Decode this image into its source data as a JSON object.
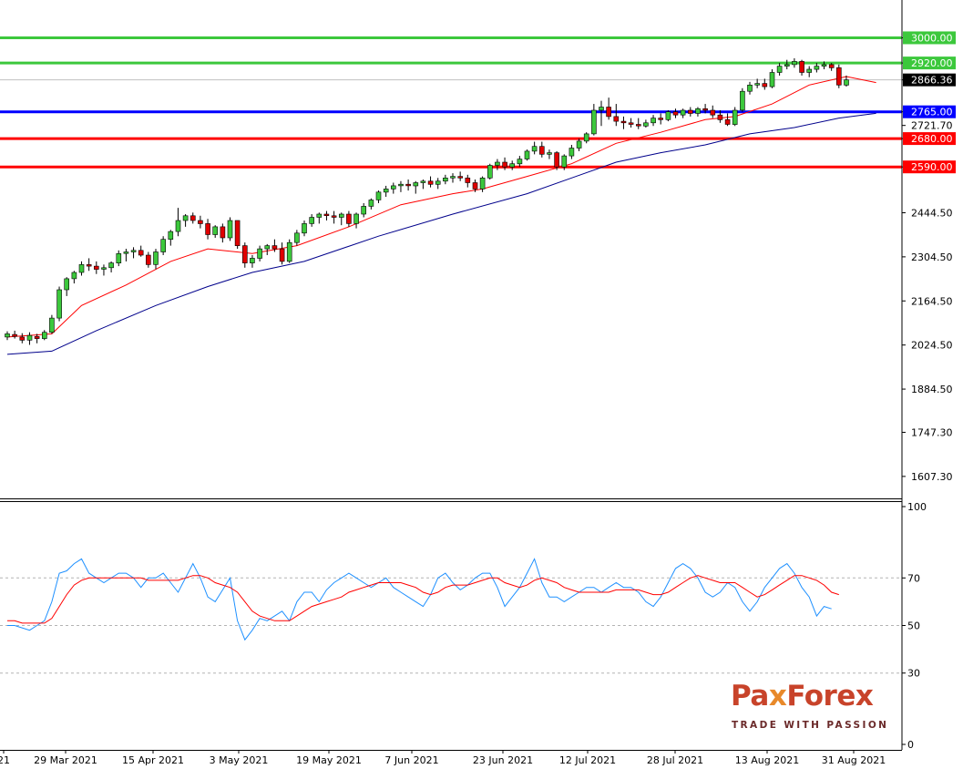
{
  "chart_data": [
    {
      "type": "candlestick",
      "panel": "price",
      "ylim": [
        1537.5,
        3120
      ],
      "y_ticks": [
        "3000.00",
        "2920.00",
        "2866.36",
        "2765.00",
        "2721.70",
        "2680.00",
        "2590.00",
        "2444.50",
        "2304.50",
        "2164.50",
        "2024.50",
        "1884.50",
        "1747.30",
        "1607.30"
      ],
      "x_labels": [
        "21",
        "29 Mar 2021",
        "15 Apr 2021",
        "3 May 2021",
        "19 May 2021",
        "7 Jun 2021",
        "23 Jun 2021",
        "12 Jul 2021",
        "28 Jul 2021",
        "13 Aug 2021",
        "31 Aug 2021"
      ],
      "levels": [
        {
          "value": 3000,
          "label": "3000.00",
          "color": "#3cc83c"
        },
        {
          "value": 2920,
          "label": "2920.00",
          "color": "#3cc83c"
        },
        {
          "value": 2765,
          "label": "2765.00",
          "color": "#0000ff"
        },
        {
          "value": 2680,
          "label": "2680.00",
          "color": "#ff0000"
        },
        {
          "value": 2590,
          "label": "2590.00",
          "color": "#ff0000"
        }
      ],
      "current_price": {
        "value": 2866.36,
        "label": "2866.36"
      },
      "ohlc": [
        [
          2050,
          2068,
          2040,
          2060
        ],
        [
          2058,
          2070,
          2045,
          2052
        ],
        [
          2050,
          2062,
          2030,
          2040
        ],
        [
          2040,
          2065,
          2025,
          2055
        ],
        [
          2052,
          2060,
          2030,
          2045
        ],
        [
          2045,
          2072,
          2040,
          2065
        ],
        [
          2065,
          2120,
          2060,
          2110
        ],
        [
          2110,
          2210,
          2100,
          2200
        ],
        [
          2200,
          2240,
          2180,
          2235
        ],
        [
          2235,
          2260,
          2220,
          2255
        ],
        [
          2255,
          2290,
          2245,
          2280
        ],
        [
          2280,
          2300,
          2260,
          2275
        ],
        [
          2275,
          2290,
          2250,
          2265
        ],
        [
          2265,
          2280,
          2245,
          2270
        ],
        [
          2270,
          2290,
          2255,
          2285
        ],
        [
          2285,
          2325,
          2275,
          2315
        ],
        [
          2315,
          2330,
          2290,
          2320
        ],
        [
          2320,
          2335,
          2300,
          2325
        ],
        [
          2325,
          2340,
          2305,
          2310
        ],
        [
          2310,
          2320,
          2270,
          2280
        ],
        [
          2280,
          2330,
          2265,
          2320
        ],
        [
          2320,
          2370,
          2310,
          2360
        ],
        [
          2360,
          2390,
          2340,
          2385
        ],
        [
          2385,
          2460,
          2370,
          2420
        ],
        [
          2420,
          2440,
          2400,
          2435
        ],
        [
          2435,
          2445,
          2410,
          2420
        ],
        [
          2420,
          2435,
          2395,
          2410
        ],
        [
          2410,
          2425,
          2360,
          2375
        ],
        [
          2375,
          2405,
          2365,
          2400
        ],
        [
          2400,
          2410,
          2350,
          2365
        ],
        [
          2365,
          2430,
          2355,
          2420
        ],
        [
          2420,
          2420,
          2330,
          2340
        ],
        [
          2340,
          2350,
          2270,
          2285
        ],
        [
          2285,
          2310,
          2270,
          2300
        ],
        [
          2300,
          2340,
          2290,
          2330
        ],
        [
          2330,
          2345,
          2310,
          2340
        ],
        [
          2340,
          2360,
          2320,
          2330
        ],
        [
          2330,
          2350,
          2280,
          2290
        ],
        [
          2290,
          2360,
          2285,
          2350
        ],
        [
          2350,
          2390,
          2340,
          2380
        ],
        [
          2380,
          2420,
          2370,
          2410
        ],
        [
          2410,
          2440,
          2400,
          2430
        ],
        [
          2430,
          2445,
          2410,
          2440
        ],
        [
          2440,
          2450,
          2420,
          2435
        ],
        [
          2435,
          2450,
          2410,
          2430
        ],
        [
          2430,
          2445,
          2405,
          2440
        ],
        [
          2440,
          2450,
          2400,
          2410
        ],
        [
          2410,
          2445,
          2395,
          2440
        ],
        [
          2440,
          2475,
          2430,
          2465
        ],
        [
          2465,
          2490,
          2455,
          2485
        ],
        [
          2485,
          2515,
          2475,
          2510
        ],
        [
          2510,
          2530,
          2495,
          2520
        ],
        [
          2520,
          2540,
          2505,
          2530
        ],
        [
          2530,
          2545,
          2510,
          2535
        ],
        [
          2535,
          2550,
          2515,
          2530
        ],
        [
          2530,
          2545,
          2505,
          2540
        ],
        [
          2540,
          2550,
          2520,
          2545
        ],
        [
          2545,
          2560,
          2525,
          2535
        ],
        [
          2535,
          2555,
          2520,
          2545
        ],
        [
          2545,
          2565,
          2535,
          2555
        ],
        [
          2555,
          2570,
          2540,
          2560
        ],
        [
          2560,
          2575,
          2545,
          2555
        ],
        [
          2555,
          2565,
          2525,
          2540
        ],
        [
          2540,
          2550,
          2510,
          2520
        ],
        [
          2520,
          2560,
          2510,
          2555
        ],
        [
          2555,
          2600,
          2550,
          2595
        ],
        [
          2595,
          2615,
          2580,
          2605
        ],
        [
          2605,
          2620,
          2580,
          2590
        ],
        [
          2590,
          2610,
          2580,
          2600
        ],
        [
          2600,
          2625,
          2590,
          2615
        ],
        [
          2615,
          2645,
          2610,
          2640
        ],
        [
          2640,
          2670,
          2630,
          2655
        ],
        [
          2655,
          2670,
          2620,
          2630
        ],
        [
          2630,
          2645,
          2615,
          2635
        ],
        [
          2635,
          2640,
          2580,
          2590
        ],
        [
          2590,
          2630,
          2580,
          2625
        ],
        [
          2625,
          2660,
          2615,
          2650
        ],
        [
          2650,
          2680,
          2640,
          2672
        ],
        [
          2672,
          2700,
          2665,
          2695
        ],
        [
          2695,
          2790,
          2690,
          2770
        ],
        [
          2770,
          2800,
          2720,
          2780
        ],
        [
          2780,
          2810,
          2740,
          2750
        ],
        [
          2750,
          2790,
          2720,
          2735
        ],
        [
          2735,
          2750,
          2710,
          2730
        ],
        [
          2730,
          2745,
          2715,
          2725
        ],
        [
          2725,
          2745,
          2710,
          2720
        ],
        [
          2720,
          2740,
          2715,
          2730
        ],
        [
          2730,
          2755,
          2720,
          2745
        ],
        [
          2745,
          2760,
          2725,
          2740
        ],
        [
          2740,
          2770,
          2735,
          2765
        ],
        [
          2765,
          2775,
          2745,
          2755
        ],
        [
          2755,
          2775,
          2745,
          2770
        ],
        [
          2770,
          2780,
          2750,
          2760
        ],
        [
          2760,
          2780,
          2750,
          2775
        ],
        [
          2775,
          2790,
          2760,
          2770
        ],
        [
          2770,
          2785,
          2745,
          2755
        ],
        [
          2755,
          2770,
          2730,
          2740
        ],
        [
          2740,
          2760,
          2720,
          2725
        ],
        [
          2725,
          2780,
          2720,
          2770
        ],
        [
          2770,
          2840,
          2765,
          2830
        ],
        [
          2830,
          2860,
          2820,
          2850
        ],
        [
          2850,
          2870,
          2840,
          2855
        ],
        [
          2855,
          2870,
          2835,
          2845
        ],
        [
          2845,
          2900,
          2840,
          2890
        ],
        [
          2890,
          2920,
          2880,
          2910
        ],
        [
          2910,
          2930,
          2900,
          2915
        ],
        [
          2915,
          2935,
          2905,
          2925
        ],
        [
          2925,
          2930,
          2880,
          2890
        ],
        [
          2890,
          2910,
          2875,
          2900
        ],
        [
          2900,
          2920,
          2890,
          2910
        ],
        [
          2910,
          2925,
          2900,
          2915
        ],
        [
          2915,
          2920,
          2895,
          2905
        ],
        [
          2905,
          2915,
          2840,
          2850
        ],
        [
          2850,
          2880,
          2845,
          2866.36
        ]
      ],
      "ma_fast": {
        "color": "#ff0000",
        "points": [
          [
            0,
            2050
          ],
          [
            6,
            2060
          ],
          [
            10,
            2150
          ],
          [
            16,
            2215
          ],
          [
            22,
            2290
          ],
          [
            27,
            2330
          ],
          [
            33,
            2315
          ],
          [
            39,
            2340
          ],
          [
            46,
            2400
          ],
          [
            53,
            2470
          ],
          [
            60,
            2505
          ],
          [
            64,
            2520
          ],
          [
            70,
            2560
          ],
          [
            76,
            2600
          ],
          [
            82,
            2665
          ],
          [
            88,
            2700
          ],
          [
            94,
            2740
          ],
          [
            98,
            2750
          ],
          [
            103,
            2790
          ],
          [
            108,
            2850
          ],
          [
            113,
            2877
          ],
          [
            117,
            2858
          ]
        ]
      },
      "ma_slow": {
        "color": "#00008b",
        "points": [
          [
            0,
            1995
          ],
          [
            6,
            2005
          ],
          [
            12,
            2070
          ],
          [
            20,
            2150
          ],
          [
            27,
            2210
          ],
          [
            33,
            2255
          ],
          [
            40,
            2290
          ],
          [
            50,
            2370
          ],
          [
            60,
            2440
          ],
          [
            70,
            2505
          ],
          [
            76,
            2555
          ],
          [
            82,
            2605
          ],
          [
            88,
            2635
          ],
          [
            94,
            2660
          ],
          [
            100,
            2695
          ],
          [
            106,
            2715
          ],
          [
            112,
            2745
          ],
          [
            117,
            2760
          ]
        ]
      }
    },
    {
      "type": "line",
      "panel": "oscillator",
      "ylim": [
        0,
        100
      ],
      "y_ticks": [
        "100",
        "70",
        "50",
        "30",
        "0"
      ],
      "levels": [
        70,
        50,
        30
      ],
      "series": [
        {
          "color": "#1e90ff",
          "values": [
            50,
            50,
            49,
            48,
            50,
            52,
            60,
            72,
            73,
            76,
            78,
            72,
            70,
            68,
            70,
            72,
            72,
            70,
            66,
            70,
            70,
            72,
            68,
            64,
            70,
            76,
            70,
            62,
            60,
            65,
            70,
            52,
            44,
            48,
            53,
            52,
            54,
            56,
            52,
            60,
            64,
            64,
            60,
            65,
            68,
            70,
            72,
            70,
            68,
            66,
            68,
            70,
            66,
            64,
            62,
            60,
            58,
            63,
            70,
            72,
            68,
            65,
            67,
            70,
            72,
            72,
            66,
            58,
            62,
            66,
            72,
            78,
            68,
            62,
            62,
            60,
            62,
            64,
            66,
            66,
            64,
            66,
            68,
            66,
            66,
            64,
            60,
            58,
            62,
            68,
            74,
            76,
            74,
            70,
            64,
            62,
            64,
            68,
            66,
            60,
            56,
            60,
            66,
            70,
            74,
            76,
            72,
            66,
            62,
            54,
            58,
            57
          ]
        },
        {
          "color": "#ff0000",
          "values": [
            52,
            52,
            51,
            51,
            51,
            51,
            53,
            58,
            63,
            67,
            69,
            70,
            70,
            70,
            70,
            70,
            70,
            70,
            70,
            69,
            69,
            69,
            69,
            69,
            70,
            71,
            71,
            70,
            68,
            67,
            66,
            64,
            60,
            56,
            54,
            53,
            52,
            52,
            52,
            54,
            56,
            58,
            59,
            60,
            61,
            62,
            64,
            65,
            66,
            67,
            68,
            68,
            68,
            68,
            67,
            66,
            64,
            63,
            64,
            66,
            67,
            67,
            67,
            68,
            69,
            70,
            70,
            68,
            67,
            66,
            67,
            69,
            70,
            69,
            68,
            66,
            65,
            64,
            64,
            64,
            64,
            64,
            65,
            65,
            65,
            65,
            64,
            63,
            63,
            64,
            66,
            68,
            70,
            71,
            70,
            69,
            68,
            68,
            68,
            66,
            64,
            62,
            63,
            65,
            67,
            69,
            71,
            71,
            70,
            69,
            67,
            64,
            63
          ]
        }
      ]
    }
  ],
  "watermark": {
    "brand_part1": "Pa",
    "brand_x": "x",
    "brand_part2": "Forex",
    "tagline": "TRADE WITH PASSION"
  }
}
